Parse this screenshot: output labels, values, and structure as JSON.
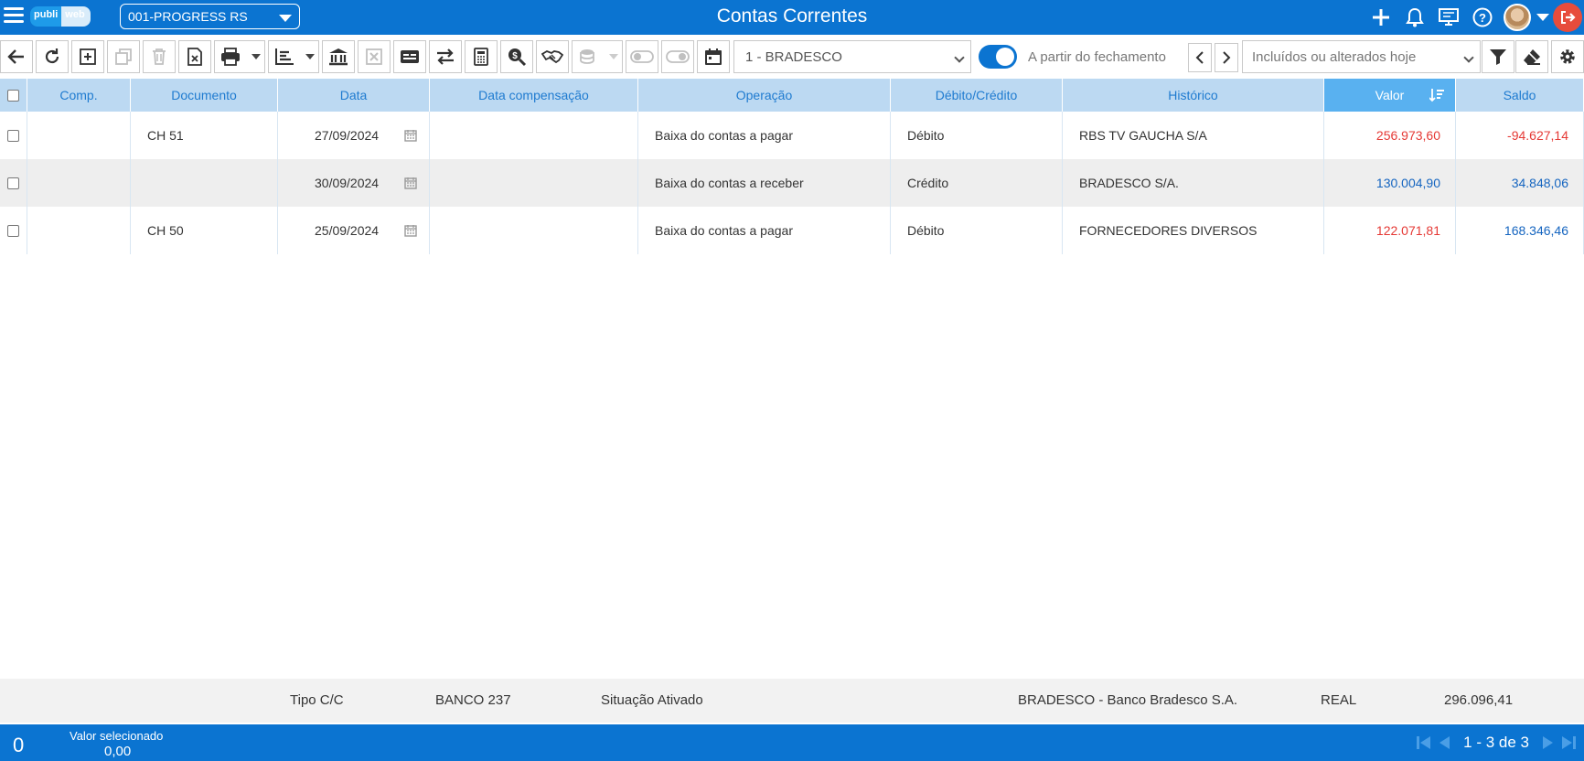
{
  "header": {
    "logo_part1": "publi",
    "logo_part2": "web",
    "company": "001-PROGRESS RS",
    "title": "Contas Correntes"
  },
  "toolbar": {
    "bank": "1 - BRADESCO",
    "toggle_label": "A partir do fechamento",
    "toggle_on": true,
    "filter": "Incluídos ou alterados hoje"
  },
  "table": {
    "columns": [
      "Comp.",
      "Documento",
      "Data",
      "Data compensação",
      "Operação",
      "Débito/Crédito",
      "Histórico",
      "Valor",
      "Saldo"
    ],
    "sorted_column": "Valor",
    "rows": [
      {
        "comp": "",
        "documento": "CH 51",
        "data": "27/09/2024",
        "data_comp": "",
        "operacao": "Baixa do contas a pagar",
        "dc": "Débito",
        "historico": "RBS TV GAUCHA S/A",
        "valor": "256.973,60",
        "saldo": "-94.627,14"
      },
      {
        "comp": "",
        "documento": "",
        "data": "30/09/2024",
        "data_comp": "",
        "operacao": "Baixa do contas a receber",
        "dc": "Crédito",
        "historico": "BRADESCO S/A.",
        "valor": "130.004,90",
        "saldo": "34.848,06"
      },
      {
        "comp": "",
        "documento": "CH 50",
        "data": "25/09/2024",
        "data_comp": "",
        "operacao": "Baixa do contas a pagar",
        "dc": "Débito",
        "historico": "FORNECEDORES DIVERSOS",
        "valor": "122.071,81",
        "saldo": "168.346,46"
      }
    ]
  },
  "summary": {
    "tipo": "Tipo C/C",
    "banco": "BANCO 237",
    "situacao": "Situação Ativado",
    "banco_nome": "BRADESCO - Banco Bradesco S.A.",
    "moeda": "REAL",
    "total": "296.096,41"
  },
  "status": {
    "selected_count": "0",
    "selected_label": "Valor selecionado",
    "selected_value": "0,00",
    "page_info": "1 - 3 de 3"
  },
  "colors": {
    "primary": "#0b74d1",
    "header_bg": "#bcd9f2",
    "sorted_bg": "#59b1f0",
    "negative": "#e53935",
    "positive": "#1565c0"
  }
}
